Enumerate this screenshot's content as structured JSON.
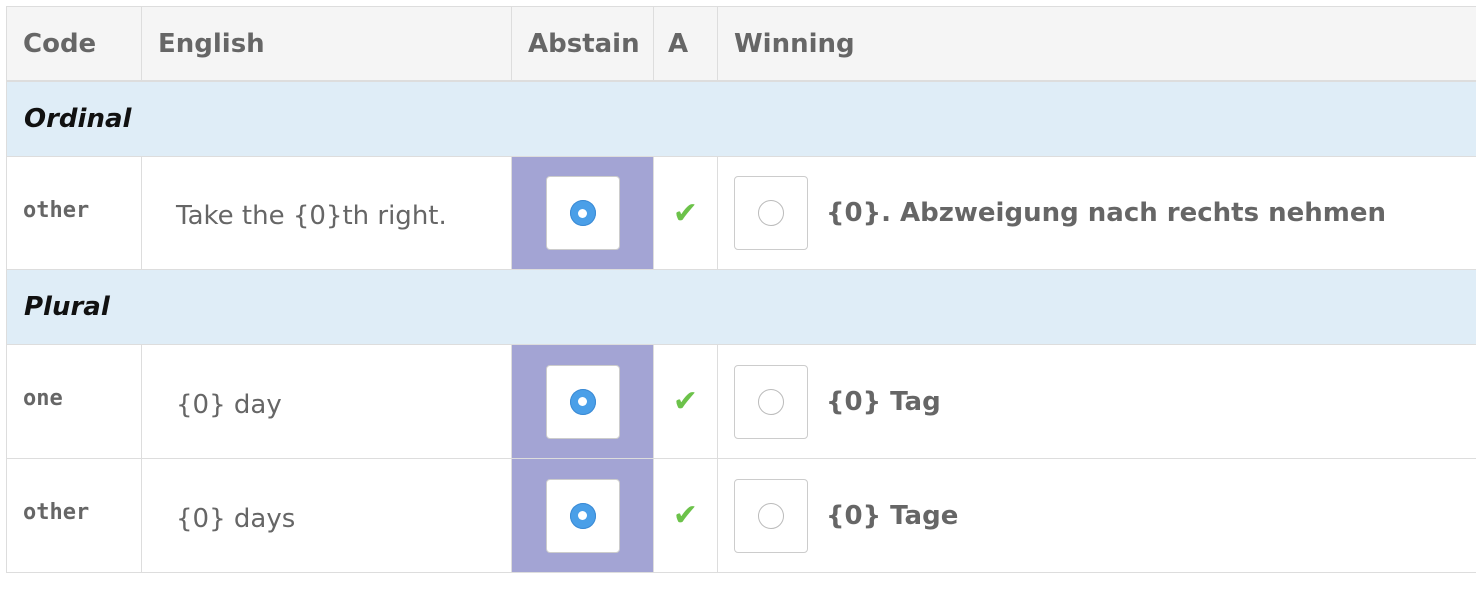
{
  "header": {
    "code": "Code",
    "english": "English",
    "abstain": "Abstain",
    "a": "A",
    "winning": "Winning"
  },
  "sections": [
    {
      "title": "Ordinal",
      "rows": [
        {
          "code": "other",
          "english": "Take the {0}th right.",
          "check": "✔",
          "winning": "{0}. Abzweigung nach rechts nehmen"
        }
      ]
    },
    {
      "title": "Plural",
      "rows": [
        {
          "code": "one",
          "english": "{0} day",
          "check": "✔",
          "winning": "{0} Tag"
        },
        {
          "code": "other",
          "english": "{0} days",
          "check": "✔",
          "winning": "{0} Tage"
        }
      ]
    }
  ],
  "colors": {
    "section_bg": "#dfedf7",
    "abstain_bg": "#a3a4d4",
    "radio_selected": "#4a9fe8",
    "check": "#6cc24a"
  },
  "icons": {
    "abstain_radio": "radio-selected-icon",
    "approved": "checkmark-icon",
    "vote_radio": "radio-unselected-icon"
  }
}
